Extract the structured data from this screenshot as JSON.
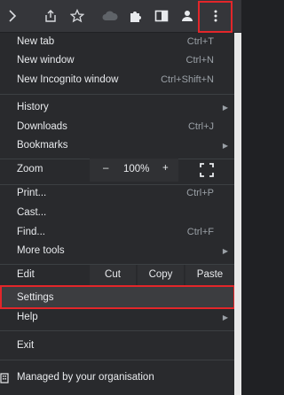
{
  "toolbar": {
    "icons": [
      "share-icon",
      "star-icon",
      "cloud-icon",
      "extensions-icon",
      "side-panel-icon",
      "profile-icon",
      "more-menu-icon"
    ]
  },
  "menu": {
    "new_tab": {
      "label": "New tab",
      "shortcut": "Ctrl+T"
    },
    "new_window": {
      "label": "New window",
      "shortcut": "Ctrl+N"
    },
    "new_incognito": {
      "label": "New Incognito window",
      "shortcut": "Ctrl+Shift+N"
    },
    "history": {
      "label": "History"
    },
    "downloads": {
      "label": "Downloads",
      "shortcut": "Ctrl+J"
    },
    "bookmarks": {
      "label": "Bookmarks"
    },
    "zoom": {
      "label": "Zoom",
      "minus": "–",
      "value": "100%",
      "plus": "+"
    },
    "print": {
      "label": "Print...",
      "shortcut": "Ctrl+P"
    },
    "cast": {
      "label": "Cast..."
    },
    "find": {
      "label": "Find...",
      "shortcut": "Ctrl+F"
    },
    "more_tools": {
      "label": "More tools"
    },
    "edit": {
      "label": "Edit",
      "cut": "Cut",
      "copy": "Copy",
      "paste": "Paste"
    },
    "settings": {
      "label": "Settings"
    },
    "help": {
      "label": "Help"
    },
    "exit": {
      "label": "Exit"
    },
    "managed": {
      "label": "Managed by your organisation"
    }
  },
  "colors": {
    "highlight": "#e3262a",
    "menu_bg": "#292a2d",
    "toolbar_bg": "#35363a"
  }
}
